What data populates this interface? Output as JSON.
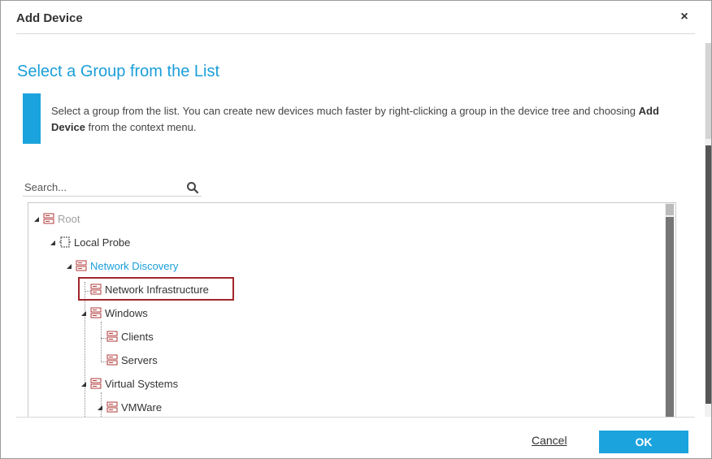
{
  "dialog": {
    "title": "Add Device",
    "close_label": "×",
    "heading": "Select a Group from the List",
    "info_text_before": "Select a group from the list. You can create new devices much faster by right-clicking a group in the device tree and choosing ",
    "info_text_bold": "Add Device",
    "info_text_after": " from the context menu."
  },
  "search": {
    "placeholder": "Search...",
    "icon": "search-icon"
  },
  "tree": {
    "nodes": [
      {
        "label": "Root",
        "icon": "group-icon",
        "style": "muted",
        "expander": "expanded"
      },
      {
        "label": "Local Probe",
        "icon": "probe-icon",
        "style": "normal",
        "expander": "expanded"
      },
      {
        "label": "Network Discovery",
        "icon": "group-icon",
        "style": "link",
        "expander": "expanded"
      },
      {
        "label": "Network Infrastructure",
        "icon": "group-icon",
        "style": "normal",
        "expander": "none",
        "selected": true
      },
      {
        "label": "Windows",
        "icon": "group-icon",
        "style": "normal",
        "expander": "expanded"
      },
      {
        "label": "Clients",
        "icon": "group-icon",
        "style": "normal",
        "expander": "none"
      },
      {
        "label": "Servers",
        "icon": "group-icon",
        "style": "normal",
        "expander": "none"
      },
      {
        "label": "Virtual Systems",
        "icon": "group-icon",
        "style": "normal",
        "expander": "expanded"
      },
      {
        "label": "VMWare",
        "icon": "group-icon",
        "style": "normal",
        "expander": "expanded"
      }
    ]
  },
  "footer": {
    "cancel_label": "Cancel",
    "ok_label": "OK"
  },
  "colors": {
    "accent": "#1aa3dd",
    "heading": "#1a9ed9",
    "highlight_border": "#a0262b"
  }
}
